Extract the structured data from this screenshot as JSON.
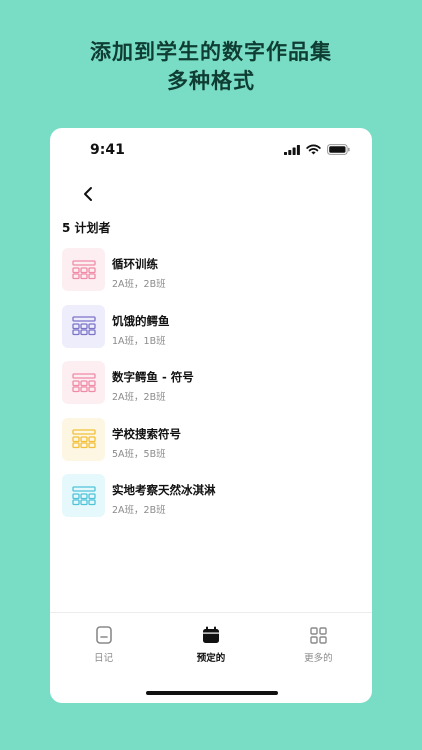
{
  "headline": {
    "line1": "添加到学生的数字作品集",
    "line2": "多种格式"
  },
  "status_bar": {
    "time": "9:41"
  },
  "section": {
    "title": "5 计划者"
  },
  "planners": [
    {
      "name": "循环训练",
      "classes": "2A班，2B班",
      "accent": "#f08aa6",
      "bg": "#fdeef2",
      "icon": "planner-grid-icon"
    },
    {
      "name": "饥饿的鳄鱼",
      "classes": "1A班，1B班",
      "accent": "#7b74c9",
      "bg": "#eeedfb",
      "icon": "planner-grid-icon"
    },
    {
      "name": "数字鳄鱼 - 符号",
      "classes": "2A班，2B班",
      "accent": "#f08aa6",
      "bg": "#fdeef2",
      "icon": "planner-grid-icon"
    },
    {
      "name": "学校搜索符号",
      "classes": "5A班，5B班",
      "accent": "#f2bf3a",
      "bg": "#fdf6e2",
      "icon": "planner-grid-icon"
    },
    {
      "name": "实地考察天然冰淇淋",
      "classes": "2A班，2B班",
      "accent": "#4fc3d9",
      "bg": "#e5f8fb",
      "icon": "planner-grid-icon"
    }
  ],
  "tabs": [
    {
      "label": "日记",
      "icon": "journal-icon",
      "active": false
    },
    {
      "label": "预定的",
      "icon": "calendar-icon",
      "active": true
    },
    {
      "label": "更多的",
      "icon": "grid-more-icon",
      "active": false
    }
  ],
  "colors": {
    "background": "#79dcc5",
    "headline": "#0f3d33",
    "card": "#ffffff"
  }
}
